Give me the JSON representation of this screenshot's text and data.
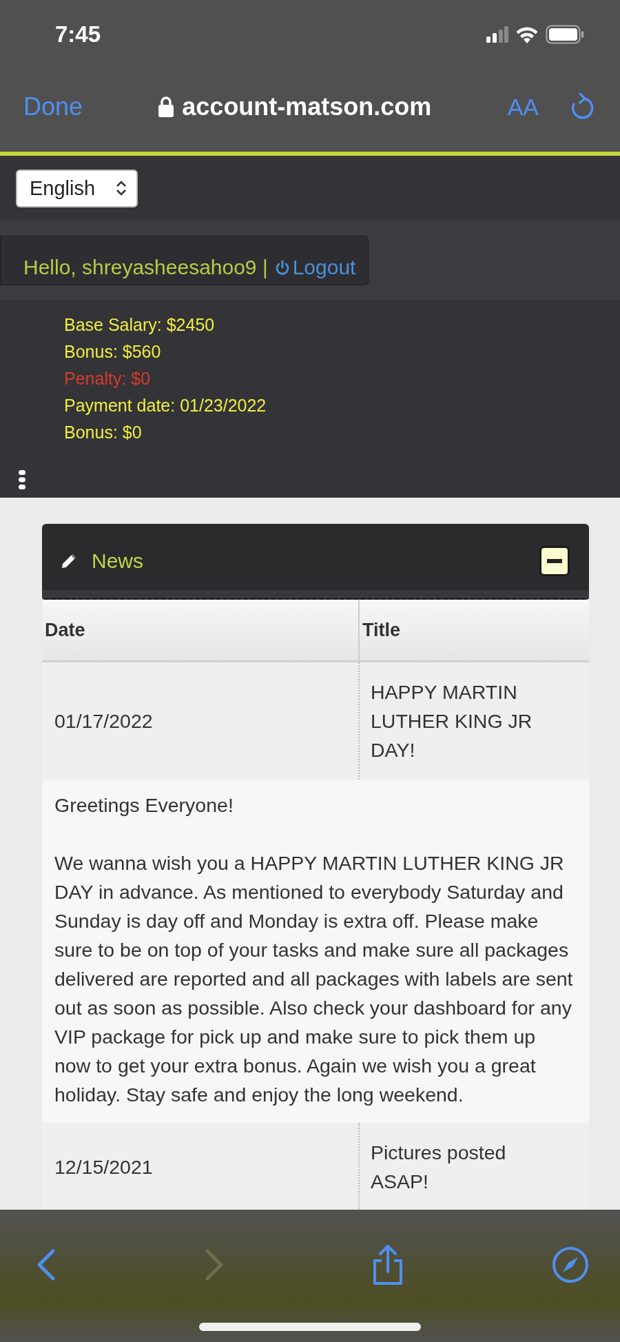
{
  "status_bar": {
    "time": "7:45"
  },
  "browser": {
    "done": "Done",
    "url": "account-matson.com",
    "text_size": "AA"
  },
  "language_select": {
    "value": "English"
  },
  "greeting": {
    "text": "Hello, shreyasheesahoo9 |",
    "logout": "Logout"
  },
  "salary": [
    {
      "text": "Base Salary: $2450",
      "color": "#f0ee3c"
    },
    {
      "text": "Bonus: $560",
      "color": "#f0ee3c"
    },
    {
      "text": "Penalty: $0",
      "color": "#d93a2b"
    },
    {
      "text": "Payment date: 01/23/2022",
      "color": "#f0ee3c"
    },
    {
      "text": "Bonus: $0",
      "color": "#f0ee3c"
    }
  ],
  "news": {
    "title": "News",
    "expanded": true,
    "columns": [
      "Date",
      "Title"
    ],
    "rows": [
      {
        "date": "01/17/2022",
        "title": "HAPPY MARTIN LUTHER KING JR DAY!",
        "body": [
          "Greetings Everyone!",
          "We wanna wish you a HAPPY MARTIN LUTHER KING JR DAY in advance. As mentioned to everybody Saturday and Sunday is day off and Monday is extra off. Please make sure to be on top of your tasks and make sure all packages delivered are reported and all packages with labels are sent out as soon as possible. Also check your dashboard for any VIP package for pick up and make sure to pick them up now to get your extra bonus. Again we wish you a great holiday. Stay safe and enjoy the long weekend."
        ]
      },
      {
        "date": "12/15/2021",
        "title": "Pictures posted ASAP!"
      }
    ]
  },
  "toolbar": [
    {
      "kind": "back",
      "disabled": false
    },
    {
      "kind": "forward",
      "disabled": true
    },
    {
      "kind": "share",
      "disabled": false
    },
    {
      "kind": "compass",
      "disabled": false
    }
  ]
}
